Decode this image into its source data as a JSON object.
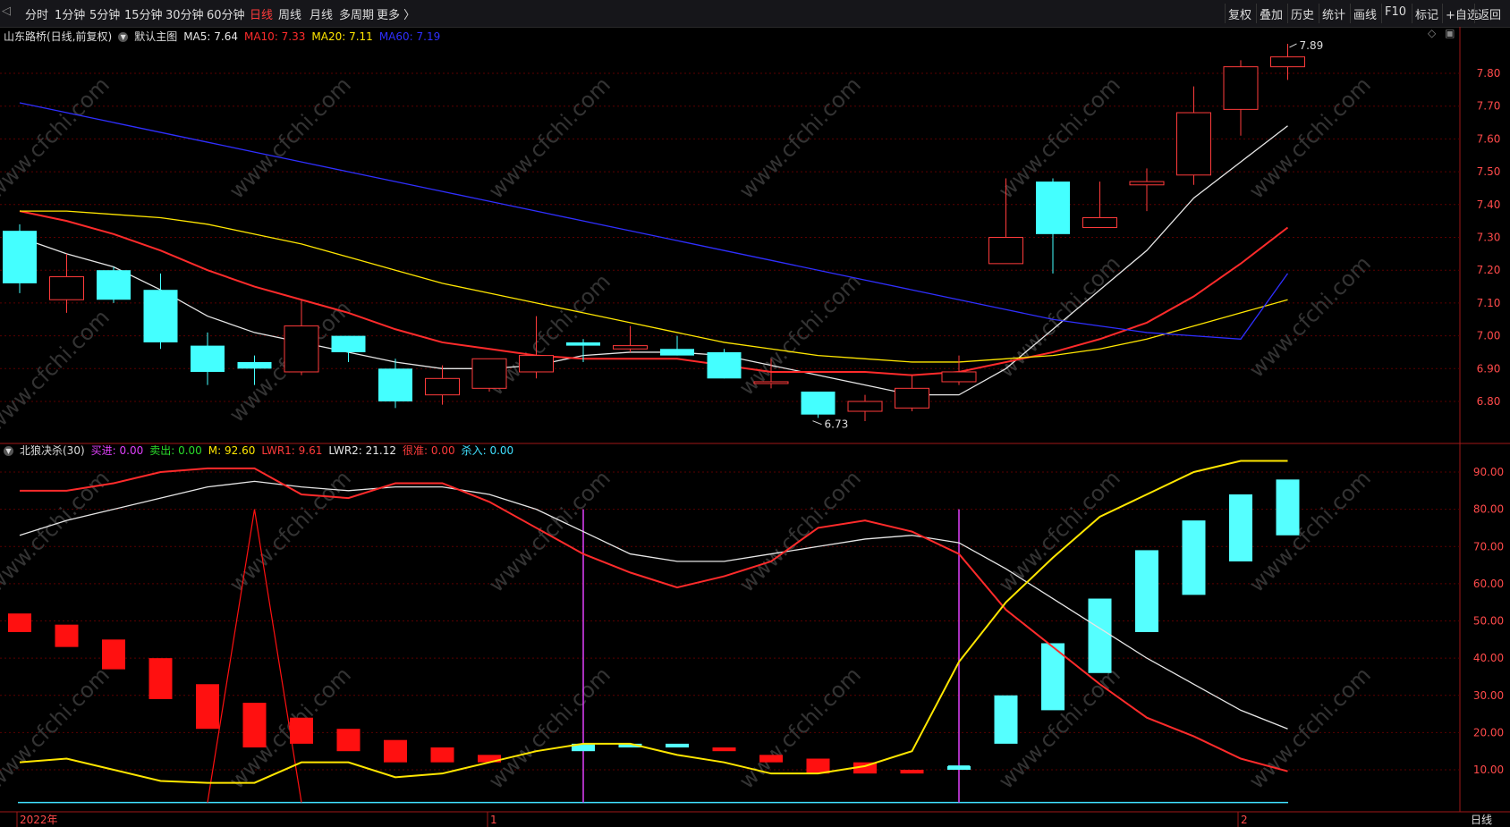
{
  "toolbar": {
    "left_items": [
      "分时",
      "1分钟",
      "5分钟",
      "15分钟",
      "30分钟",
      "60分钟",
      "日线",
      "周线",
      "月线",
      "多周期",
      "更多 〉"
    ],
    "active_index": 6,
    "right_items": [
      "复权",
      "叠加",
      "历史",
      "统计",
      "画线",
      "F10",
      "标记",
      "+自选",
      "返回"
    ]
  },
  "main_legend": {
    "stock": "山东路桥(日线,前复权)",
    "template": "默认主图",
    "ma": [
      {
        "label": "MA5: 7.64",
        "color": "#e6e6e6"
      },
      {
        "label": "MA10: 7.33",
        "color": "#ff2b2b"
      },
      {
        "label": "MA20: 7.11",
        "color": "#ffe600"
      },
      {
        "label": "MA60: 7.19",
        "color": "#2f2fff"
      }
    ]
  },
  "indicator_legend": {
    "name": "北狼决杀(30)",
    "items": [
      {
        "label": "买进: 0.00",
        "color": "#e040fb"
      },
      {
        "label": "卖出: 0.00",
        "color": "#2bdc2b"
      },
      {
        "label": "M: 92.60",
        "color": "#ffe600"
      },
      {
        "label": "LWR1: 9.61",
        "color": "#ff3b3b"
      },
      {
        "label": "LWR2: 21.12",
        "color": "#e6e6e6"
      },
      {
        "label": "很准: 0.00",
        "color": "#ff3b3b"
      },
      {
        "label": "杀入: 0.00",
        "color": "#40e0ff"
      }
    ]
  },
  "price_axis": {
    "ticks": [
      "7.80",
      "7.70",
      "7.60",
      "7.50",
      "7.40",
      "7.30",
      "7.20",
      "7.10",
      "7.00",
      "6.90",
      "6.80"
    ]
  },
  "indicator_axis": {
    "ticks": [
      "90.00",
      "80.00",
      "70.00",
      "60.00",
      "50.00",
      "40.00",
      "30.00",
      "20.00",
      "10.00"
    ]
  },
  "date_axis": {
    "labels": [
      "2022年",
      "1",
      "2"
    ],
    "period_label": "日线"
  },
  "markers": {
    "high": "7.89",
    "low": "6.73"
  },
  "watermark": "www.cfchi.com",
  "colors": {
    "up": "#ff3b3b",
    "down": "#44ffff",
    "grid": "#5a0000",
    "axis": "#a01818"
  },
  "chart_data": [
    {
      "type": "candlestick",
      "ylim": [
        6.7,
        7.92
      ],
      "ohlc": [
        [
          7.32,
          7.34,
          7.13,
          7.16
        ],
        [
          7.11,
          7.25,
          7.07,
          7.18
        ],
        [
          7.2,
          7.21,
          7.1,
          7.11
        ],
        [
          7.14,
          7.19,
          6.96,
          6.98
        ],
        [
          6.97,
          7.01,
          6.85,
          6.89
        ],
        [
          6.92,
          6.94,
          6.85,
          6.9
        ],
        [
          6.89,
          7.11,
          6.88,
          7.03
        ],
        [
          7.0,
          7.0,
          6.92,
          6.95
        ],
        [
          6.9,
          6.93,
          6.78,
          6.8
        ],
        [
          6.82,
          6.91,
          6.79,
          6.87
        ],
        [
          6.84,
          6.93,
          6.83,
          6.93
        ],
        [
          6.89,
          7.06,
          6.87,
          6.94
        ],
        [
          6.98,
          6.99,
          6.92,
          6.97
        ],
        [
          6.96,
          7.03,
          6.95,
          6.97
        ],
        [
          6.96,
          7.0,
          6.94,
          6.94
        ],
        [
          6.95,
          6.96,
          6.87,
          6.87
        ],
        [
          6.86,
          6.93,
          6.84,
          6.86
        ],
        [
          6.83,
          6.83,
          6.75,
          6.76
        ],
        [
          6.77,
          6.82,
          6.74,
          6.8
        ],
        [
          6.78,
          6.88,
          6.77,
          6.84
        ],
        [
          6.86,
          6.94,
          6.85,
          6.89
        ],
        [
          7.22,
          7.48,
          7.22,
          7.3
        ],
        [
          7.47,
          7.48,
          7.19,
          7.31
        ],
        [
          7.33,
          7.47,
          7.33,
          7.36
        ],
        [
          7.46,
          7.51,
          7.38,
          7.47
        ],
        [
          7.49,
          7.76,
          7.46,
          7.68
        ],
        [
          7.69,
          7.84,
          7.61,
          7.82
        ],
        [
          7.82,
          7.89,
          7.78,
          7.85
        ]
      ],
      "ma5": [
        7.3,
        7.25,
        7.21,
        7.14,
        7.06,
        7.01,
        6.98,
        6.95,
        6.92,
        6.9,
        6.9,
        6.91,
        6.94,
        6.95,
        6.95,
        6.94,
        6.91,
        6.88,
        6.85,
        6.82,
        6.82,
        6.9,
        7.02,
        7.14,
        7.26,
        7.42,
        7.53,
        7.64
      ],
      "ma10": [
        7.38,
        7.35,
        7.31,
        7.26,
        7.2,
        7.15,
        7.11,
        7.07,
        7.02,
        6.98,
        6.96,
        6.94,
        6.93,
        6.93,
        6.93,
        6.91,
        6.89,
        6.89,
        6.89,
        6.88,
        6.89,
        6.92,
        6.95,
        6.99,
        7.04,
        7.12,
        7.22,
        7.33
      ],
      "ma20": [
        7.38,
        7.38,
        7.37,
        7.36,
        7.34,
        7.31,
        7.28,
        7.24,
        7.2,
        7.16,
        7.13,
        7.1,
        7.07,
        7.04,
        7.01,
        6.98,
        6.96,
        6.94,
        6.93,
        6.92,
        6.92,
        6.93,
        6.94,
        6.96,
        6.99,
        7.03,
        7.07,
        7.11
      ],
      "ma60": [
        7.71,
        7.68,
        7.65,
        7.62,
        7.59,
        7.56,
        7.53,
        7.5,
        7.47,
        7.44,
        7.41,
        7.38,
        7.35,
        7.32,
        7.29,
        7.26,
        7.23,
        7.2,
        7.17,
        7.14,
        7.11,
        7.08,
        7.05,
        7.03,
        7.01,
        7.0,
        6.99,
        7.19
      ]
    },
    {
      "type": "indicator",
      "ylim": [
        0,
        95
      ],
      "series_names": [
        "M",
        "LWR1",
        "LWR2",
        "买进",
        "卖出",
        "很准",
        "杀入"
      ],
      "bars": [
        [
          52,
          47
        ],
        [
          49,
          43
        ],
        [
          45,
          37
        ],
        [
          40,
          29
        ],
        [
          33,
          21
        ],
        [
          28,
          16
        ],
        [
          24,
          17
        ],
        [
          21,
          15
        ],
        [
          18,
          12
        ],
        [
          16,
          12
        ],
        [
          14,
          12
        ],
        [
          null,
          null
        ],
        [
          17,
          15
        ],
        [
          17,
          16
        ],
        [
          17,
          16
        ],
        [
          16,
          15
        ],
        [
          14,
          12
        ],
        [
          13,
          9
        ],
        [
          12,
          9
        ],
        [
          10,
          9
        ],
        [
          11,
          10
        ],
        [
          17,
          30
        ],
        [
          26,
          44
        ],
        [
          36,
          56
        ],
        [
          47,
          69
        ],
        [
          57,
          77
        ],
        [
          66,
          84
        ],
        [
          73,
          88
        ]
      ],
      "bar_colors": [
        "up",
        "up",
        "up",
        "up",
        "up",
        "up",
        "up",
        "up",
        "up",
        "up",
        "up",
        "none",
        "down",
        "down",
        "down",
        "up",
        "up",
        "up",
        "up",
        "up",
        "down",
        "down",
        "down",
        "down",
        "down",
        "down",
        "down",
        "down"
      ],
      "m": [
        12,
        13,
        10,
        7,
        6.5,
        6.5,
        12,
        12,
        8,
        9,
        12,
        15,
        17,
        17,
        14,
        12,
        9,
        9,
        11,
        15,
        39,
        55,
        67,
        78,
        84,
        90,
        93,
        93
      ],
      "lwr1": [
        85,
        85,
        87,
        90,
        91,
        91,
        84,
        83,
        87,
        87,
        82,
        75,
        68,
        63,
        59,
        62,
        66,
        75,
        77,
        74,
        68,
        53,
        43,
        33,
        24,
        19,
        13,
        9.6
      ],
      "lwr2": [
        73,
        77,
        80,
        83,
        86,
        87.5,
        86,
        85,
        86,
        86,
        84,
        80,
        74,
        68,
        66,
        66,
        68,
        70,
        72,
        73,
        71,
        64,
        56,
        48,
        40,
        33,
        26,
        21
      ],
      "buy_lines_index": [
        12,
        20
      ],
      "spike_index": 5,
      "spike_value": 80
    }
  ]
}
